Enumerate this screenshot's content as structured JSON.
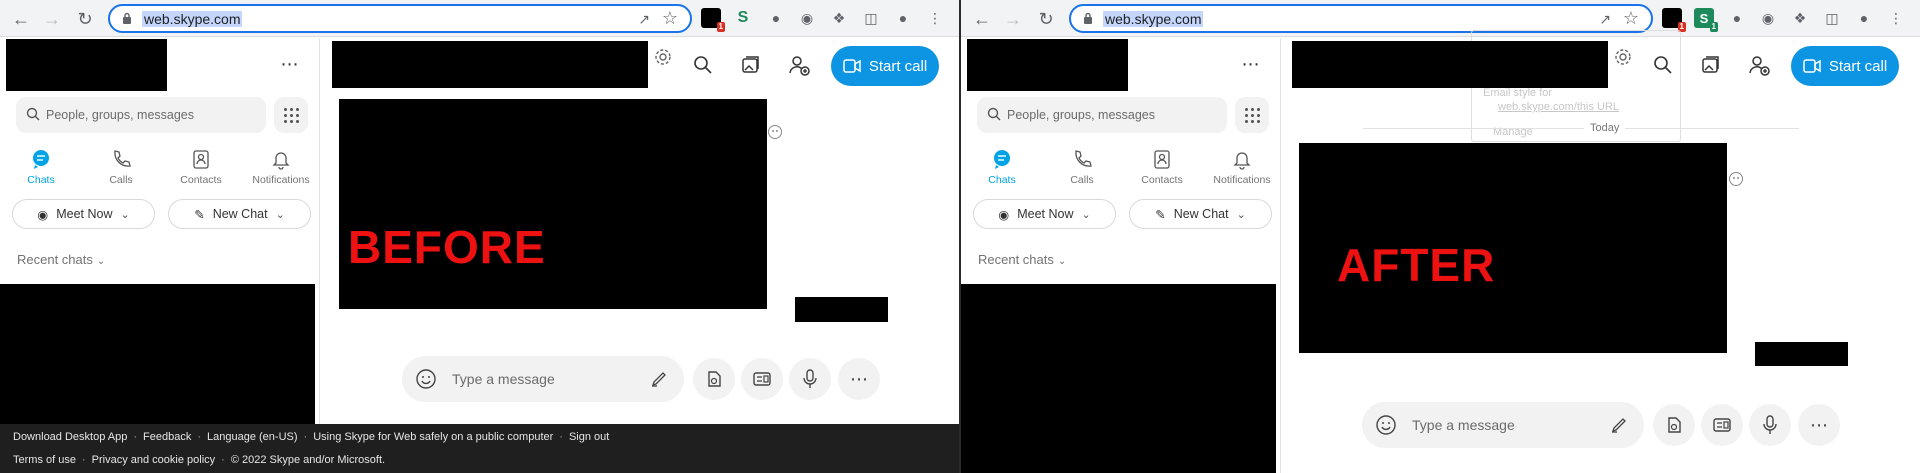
{
  "browser": {
    "url": "web.skype.com",
    "extension_badge": "1"
  },
  "sidebar": {
    "search_placeholder": "People, groups, messages",
    "tabs": [
      {
        "label": "Chats",
        "icon": "chat-icon",
        "active": true
      },
      {
        "label": "Calls",
        "icon": "phone-icon",
        "active": false
      },
      {
        "label": "Contacts",
        "icon": "contacts-icon",
        "active": false
      },
      {
        "label": "Notifications",
        "icon": "bell-icon",
        "active": false
      }
    ],
    "meet_now_label": "Meet Now",
    "new_chat_label": "New Chat",
    "recent_chats_label": "Recent chats"
  },
  "header": {
    "start_call_label": "Start call"
  },
  "composer": {
    "placeholder": "Type a message"
  },
  "before": {
    "stamp": "BEFORE"
  },
  "after": {
    "stamp": "AFTER",
    "ghost_overlay": {
      "line1": "Email style for",
      "link": "web.skype.com/this URL",
      "manage": "Manage",
      "today": "Today"
    }
  },
  "footer": {
    "links_row1": [
      "Download Desktop App",
      "Feedback",
      "Language (en-US)",
      "Using Skype for Web safely on a public computer",
      "Sign out"
    ],
    "links_row2": [
      "Terms of use",
      "Privacy and cookie policy",
      "© 2022 Skype and/or Microsoft."
    ]
  },
  "colors": {
    "accent": "#0d94e3",
    "active_tab": "#00a3e6",
    "stamp": "#ee1111",
    "footer_bg": "#1f1f1f",
    "omnibox_focus": "#1a73e8"
  }
}
